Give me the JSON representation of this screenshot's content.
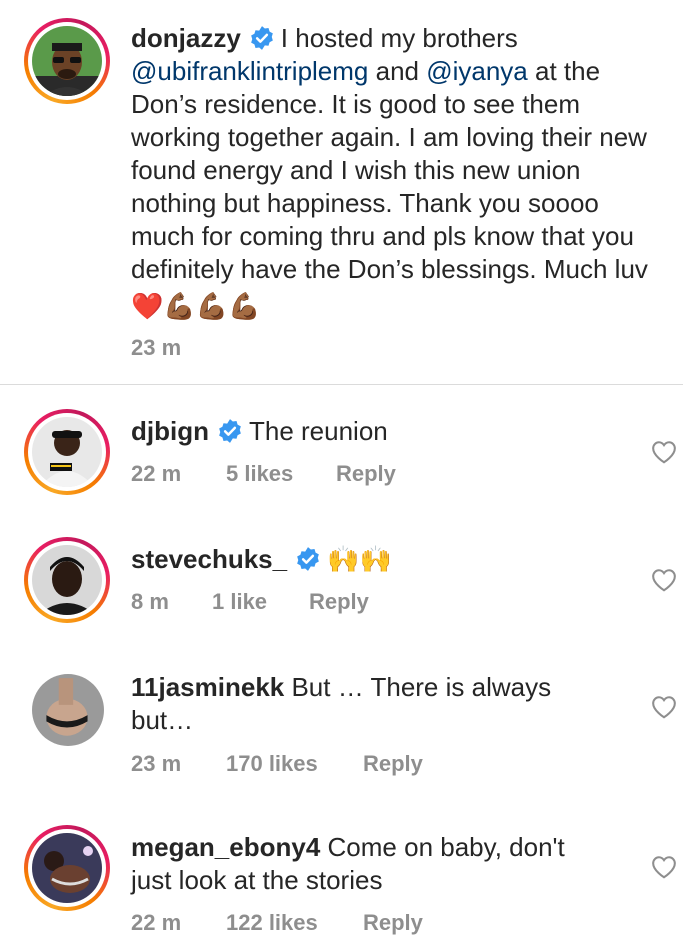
{
  "caption": {
    "username": "donjazzy",
    "text_1": "I hosted my brothers ",
    "mention_1": "@ubifranklintriplemg",
    "text_2": " and ",
    "mention_2": "@iyanya",
    "text_3": " at the Don’s residence. It is good to see them working together again. I am loving their new found energy and I wish this new union nothing but happiness. Thank you soooo much for coming thru and pls know that you definitely have the Don’s blessings. Much luv ",
    "emojis": "❤️💪🏾💪🏾💪🏾",
    "time": "23 m"
  },
  "comments": [
    {
      "username": "djbign",
      "text": "The reunion",
      "time": "22 m",
      "likes": "5 likes",
      "reply": "Reply",
      "verified": true
    },
    {
      "username": "stevechuks_",
      "text": "🙌🙌",
      "time": "8 m",
      "likes": "1 like",
      "reply": "Reply",
      "verified": true
    },
    {
      "username": "11jasminekk",
      "text": "But … There is always but…",
      "time": "23 m",
      "likes": "170 likes",
      "reply": "Reply",
      "verified": false
    },
    {
      "username": "megan_ebony4",
      "text": "Come on baby, don't just look at the stories",
      "time": "22 m",
      "likes": "122 likes",
      "reply": "Reply",
      "verified": false
    }
  ],
  "colors": {
    "verified_blue": "#3897f0",
    "mention": "#00376b",
    "meta_grey": "#8e8e8e",
    "story_ring": "#e91e63"
  },
  "icons": {
    "verified": "verified-badge-icon",
    "like": "heart-outline-icon"
  }
}
